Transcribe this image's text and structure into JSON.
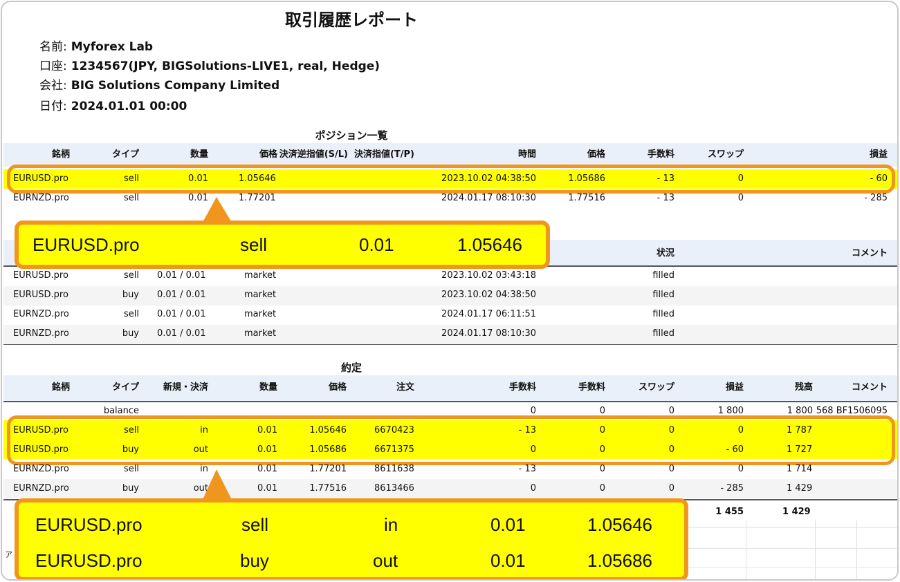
{
  "report": {
    "title": "取引履歴レポート",
    "name_label": "名前:",
    "name": "Myforex Lab",
    "account_label": "口座:",
    "account": "1234567(JPY, BIGSolutions-LIVE1, real, Hedge)",
    "company_label": "会社:",
    "company": "BIG Solutions Company Limited",
    "date_label": "日付:",
    "date": "2024.01.01 00:00"
  },
  "positions": {
    "title": "ポジション一覧",
    "headers": [
      "銘柄",
      "タイプ",
      "数量",
      "価格",
      "決済逆指値(S/L)",
      "決済指値(T/P)",
      "時間",
      "価格",
      "手数料",
      "スワップ",
      "損益"
    ],
    "rows": [
      [
        "EURUSD.pro",
        "sell",
        "0.01",
        "1.05646",
        "",
        "",
        "2023.10.02 04:38:50",
        "1.05686",
        "- 13",
        "0",
        "- 60"
      ],
      [
        "EURNZD.pro",
        "sell",
        "0.01",
        "1.77201",
        "",
        "",
        "2024.01.17 08:10:30",
        "1.77516",
        "- 13",
        "0",
        "- 285"
      ]
    ]
  },
  "orders": {
    "headers_visible": [
      "状況",
      "コメント"
    ],
    "rows": [
      [
        "EURUSD.pro",
        "sell",
        "0.01 / 0.01",
        "market",
        "2023.10.02 03:43:18",
        "filled"
      ],
      [
        "EURUSD.pro",
        "buy",
        "0.01 / 0.01",
        "market",
        "2023.10.02 04:38:50",
        "filled"
      ],
      [
        "EURNZD.pro",
        "sell",
        "0.01 / 0.01",
        "market",
        "2024.01.17 06:11:51",
        "filled"
      ],
      [
        "EURNZD.pro",
        "buy",
        "0.01 / 0.01",
        "market",
        "2024.01.17 08:10:30",
        "filled"
      ]
    ]
  },
  "deals": {
    "title": "約定",
    "headers": [
      "銘柄",
      "タイプ",
      "新規・決済",
      "数量",
      "価格",
      "注文",
      "手数料",
      "手数料",
      "スワップ",
      "損益",
      "残高",
      "コメント"
    ],
    "balance_row": [
      "balance",
      "0",
      "0",
      "0",
      "1 800",
      "1 800",
      "568 BF1506095"
    ],
    "rows": [
      [
        "EURUSD.pro",
        "sell",
        "in",
        "0.01",
        "1.05646",
        "6670423",
        "- 13",
        "0",
        "0",
        "0",
        "1 787"
      ],
      [
        "EURUSD.pro",
        "buy",
        "out",
        "0.01",
        "1.05686",
        "6671375",
        "0",
        "0",
        "0",
        "- 60",
        "1 727"
      ],
      [
        "EURNZD.pro",
        "sell",
        "in",
        "0.01",
        "1.77201",
        "8611638",
        "- 13",
        "0",
        "0",
        "0",
        "1 714"
      ],
      [
        "EURNZD.pro",
        "buy",
        "out",
        "0.01",
        "1.77516",
        "8613466",
        "0",
        "0",
        "0",
        "- 285",
        "1 429"
      ]
    ],
    "totals": [
      "1 455",
      "1 429"
    ],
    "footer_fragment": "ア"
  },
  "callout_positions": {
    "values": [
      "EURUSD.pro",
      "sell",
      "0.01",
      "1.05646"
    ]
  },
  "callout_deals": {
    "rows": [
      [
        "EURUSD.pro",
        "sell",
        "in",
        "0.01",
        "1.05646"
      ],
      [
        "EURUSD.pro",
        "buy",
        "out",
        "0.01",
        "1.05686"
      ]
    ]
  },
  "colors": {
    "highlight": "#ffff00",
    "accent_orange": "#f0961e",
    "header_bg": "#e9f0fa"
  }
}
